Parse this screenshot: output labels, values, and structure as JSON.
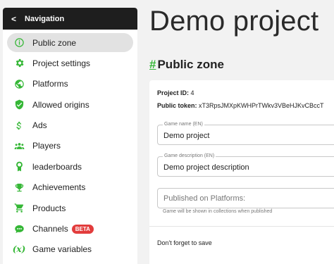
{
  "sidebar": {
    "header_label": "Navigation",
    "items": [
      {
        "label": "Public zone",
        "icon": "info-icon",
        "active": true
      },
      {
        "label": "Project settings",
        "icon": "gear-icon"
      },
      {
        "label": "Platforms",
        "icon": "globe-icon"
      },
      {
        "label": "Allowed origins",
        "icon": "shield-check-icon"
      },
      {
        "label": "Ads",
        "icon": "dollar-icon"
      },
      {
        "label": "Players",
        "icon": "people-icon"
      },
      {
        "label": "leaderboards",
        "icon": "award-icon"
      },
      {
        "label": "Achievements",
        "icon": "trophy-icon"
      },
      {
        "label": "Products",
        "icon": "cart-icon"
      },
      {
        "label": "Channels",
        "icon": "chat-icon",
        "badge": "BETA"
      },
      {
        "label": "Game variables",
        "icon": "variable-icon",
        "icon_text": "(x)"
      }
    ]
  },
  "main": {
    "title": "Demo project",
    "section_hash": "#",
    "section_title": "Public zone",
    "project_id_label": "Project ID:",
    "project_id_value": "4",
    "public_token_label": "Public token:",
    "public_token_value": "xT3RpsJMXpKWHPrTWkv3VBeHJKvCBccT",
    "game_name": {
      "label": "Game name (EN)",
      "value": "Demo project"
    },
    "game_description": {
      "label": "Game description (EN)",
      "value": "Demo project description"
    },
    "published_on": {
      "placeholder": "Published on Platforms:",
      "helper": "Game will be shown in collections when published"
    },
    "footer_note": "Don't forget to save"
  },
  "colors": {
    "accent": "#35b736",
    "header_bg": "#1e1e1e",
    "badge": "#e23c3c"
  }
}
